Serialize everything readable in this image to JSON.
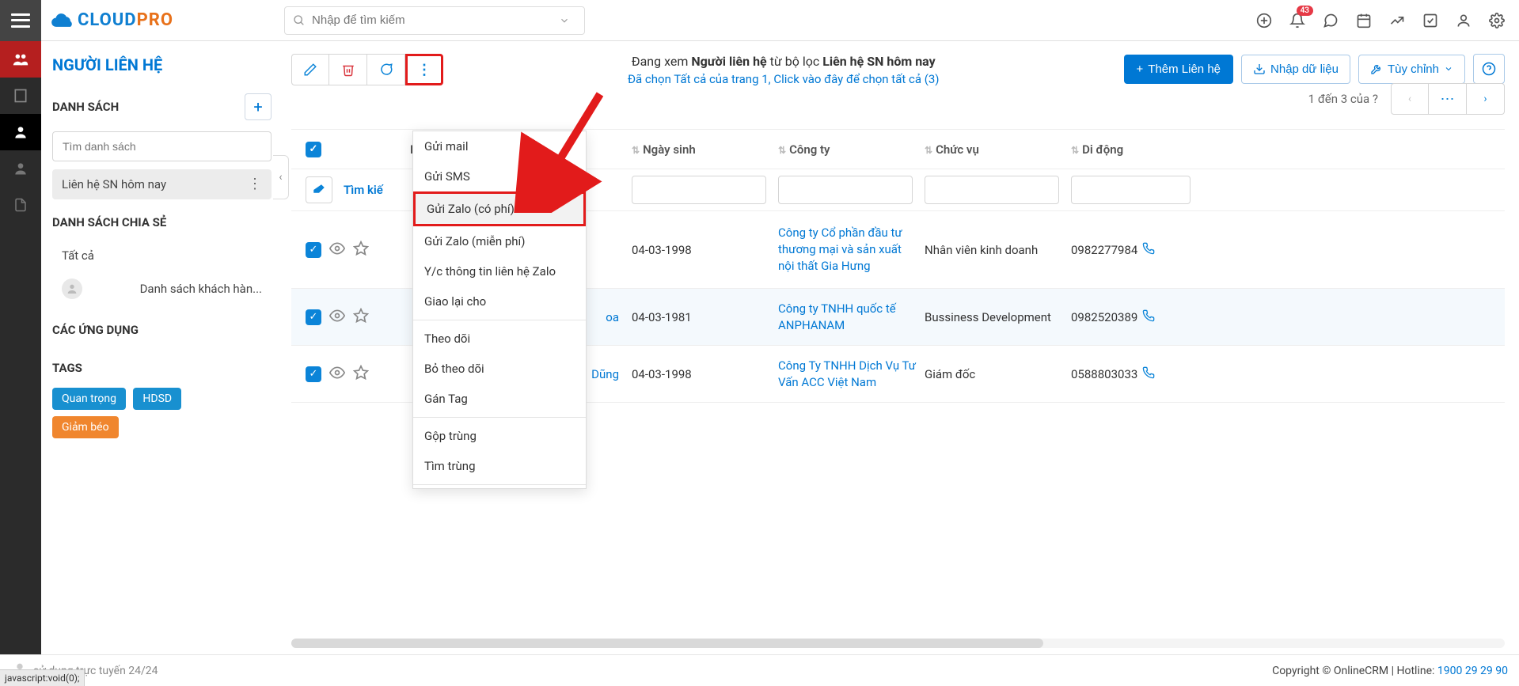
{
  "header": {
    "search_placeholder": "Nhập để tìm kiếm",
    "notification_count": "43"
  },
  "module_title": "NGƯỜI LIÊN HỆ",
  "sidebar": {
    "list_header": "DANH SÁCH",
    "search_placeholder": "Tìm danh sách",
    "current_list": "Liên hệ SN hôm nay",
    "shared_header": "DANH SÁCH CHIA SẺ",
    "shared_all": "Tất cả",
    "shared_item": "Danh sách khách hàn...",
    "apps_header": "CÁC ỨNG DỤNG",
    "tags_header": "TAGS",
    "tags": [
      "Quan trọng",
      "HDSD",
      "Giảm béo"
    ]
  },
  "toolbar": {
    "add_contact": "Thêm Liên hệ",
    "import": "Nhập dữ liệu",
    "customize": "Tùy chỉnh",
    "viewing_prefix": "Đang xem ",
    "viewing_bold1": "Người liên hệ",
    "viewing_mid": " từ bộ lọc ",
    "viewing_bold2": "Liên hệ SN hôm nay",
    "select_line": "Đã chọn Tất cả của trang 1, Click vào đây để chọn tất cả (3)",
    "count_text": "1 đến 3 của  ?"
  },
  "columns": {
    "name_partial": "B",
    "birthday": "Ngày sinh",
    "company": "Công ty",
    "role": "Chức vụ",
    "mobile": "Di động"
  },
  "search_row": {
    "prefix": "Tìm kiế"
  },
  "rows": [
    {
      "name_suffix": "",
      "birthday": "04-03-1998",
      "company": "Công ty Cổ phần đầu tư thương mại và sản xuất nội thất Gia Hưng",
      "role": "Nhân viên kinh doanh",
      "phone": "0982277984"
    },
    {
      "name_suffix": "oa",
      "birthday": "04-03-1981",
      "company": "Công ty TNHH quốc tế ANPHANAM",
      "role": "Bussiness Development",
      "phone": "0982520389"
    },
    {
      "name_suffix": "Dũng",
      "birthday": "04-03-1998",
      "company": "Công Ty TNHH Dịch Vụ Tư Vấn ACC Việt Nam",
      "role": "Giám đốc",
      "phone": "0588803033"
    }
  ],
  "dropdown": {
    "items": [
      "Gửi mail",
      "Gửi SMS",
      "Gửi Zalo (có phí)",
      "Gửi Zalo (miễn phí)",
      "Y/c thông tin liên hệ Zalo",
      "Giao lại cho"
    ],
    "items2": [
      "Theo dõi",
      "Bỏ theo dõi",
      "Gán Tag"
    ],
    "items3": [
      "Gộp trùng",
      "Tìm trùng"
    ]
  },
  "footer": {
    "support": "sử dụng trực tuyến 24/24",
    "copyright": "Copyright © OnlineCRM",
    "hotline_label": "Hotline: ",
    "hotline": "1900 29 29 90",
    "jsvoid": "javascript:void(0);"
  }
}
